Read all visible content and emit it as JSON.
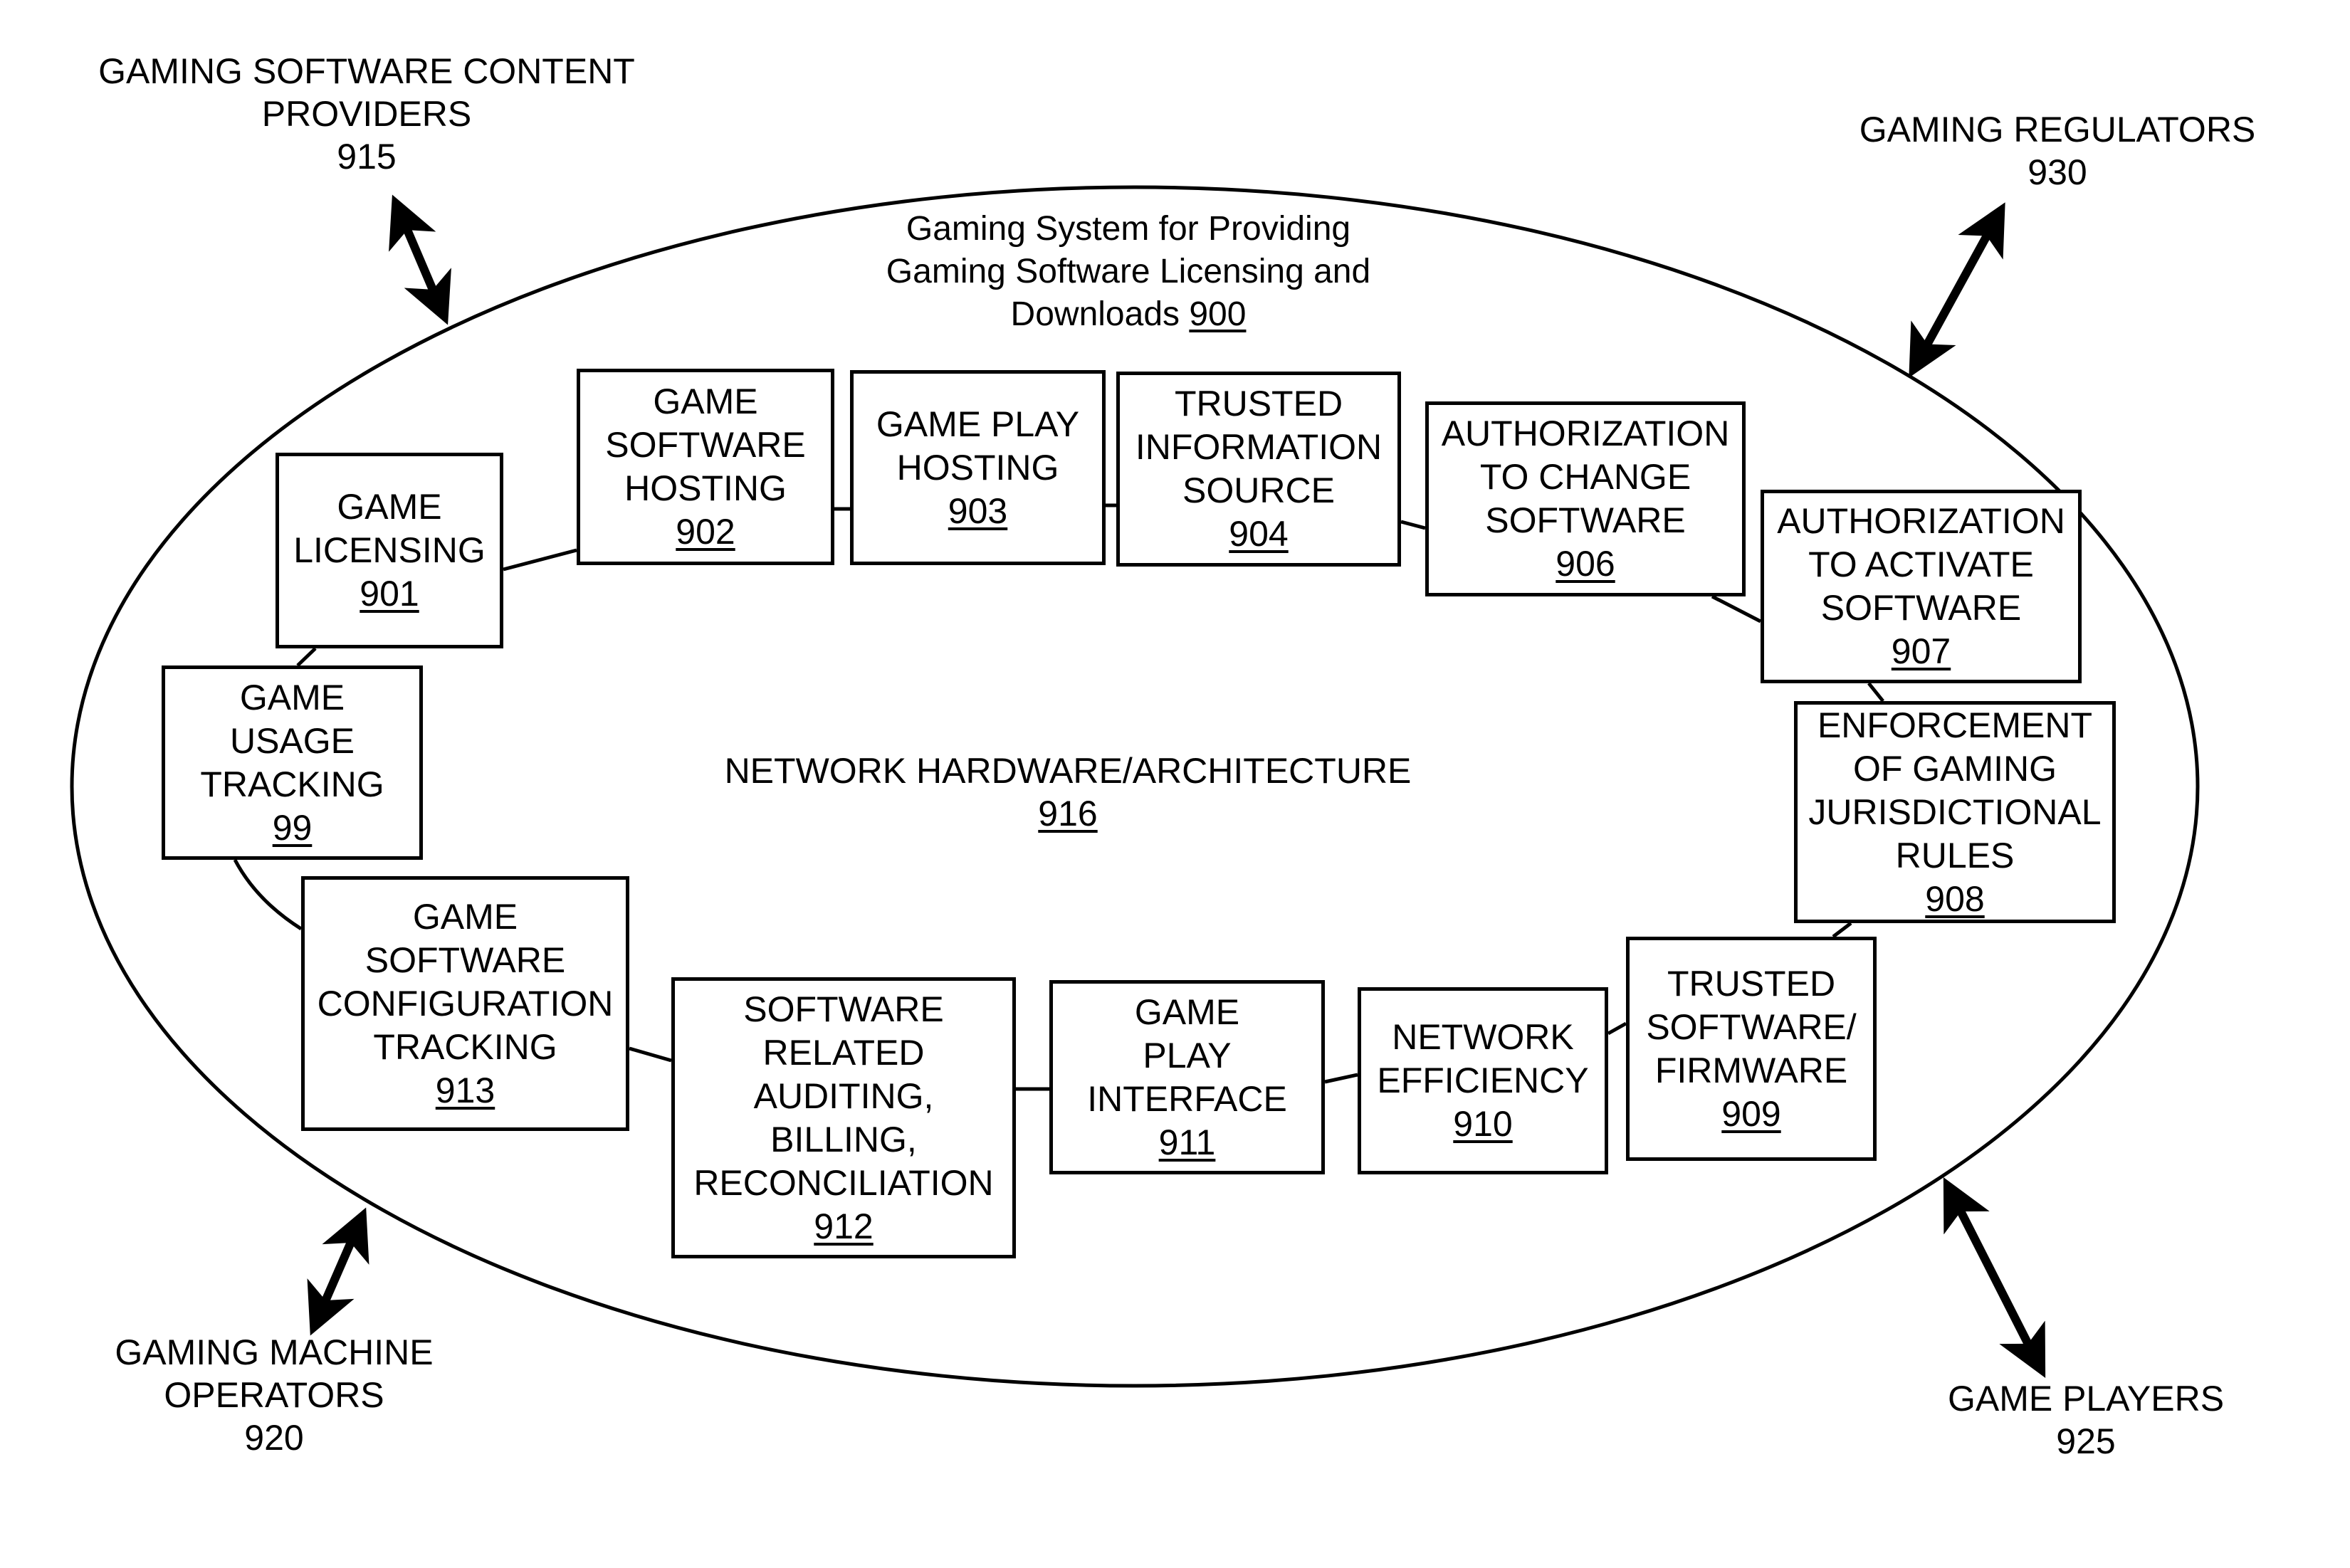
{
  "system": {
    "title_lines": [
      "Gaming System for Providing",
      "Gaming  Software Licensing and",
      "Downloads"
    ],
    "ref": "900"
  },
  "network": {
    "label": "NETWORK HARDWARE/ARCHITECTURE",
    "ref": "916"
  },
  "external_entities": [
    {
      "id": "content-providers",
      "lines": [
        "GAMING SOFTWARE CONTENT",
        "PROVIDERS"
      ],
      "ref": "915"
    },
    {
      "id": "regulators",
      "lines": [
        "GAMING REGULATORS"
      ],
      "ref": "930"
    },
    {
      "id": "machine-operators",
      "lines": [
        "GAMING MACHINE",
        "OPERATORS"
      ],
      "ref": "920"
    },
    {
      "id": "game-players",
      "lines": [
        "GAME PLAYERS"
      ],
      "ref": "925"
    }
  ],
  "modules": [
    {
      "id": "game-licensing",
      "lines": [
        "GAME",
        "LICENSING"
      ],
      "ref": "901"
    },
    {
      "id": "game-software-hosting",
      "lines": [
        "GAME",
        "SOFTWARE",
        "HOSTING"
      ],
      "ref": "902"
    },
    {
      "id": "game-play-hosting",
      "lines": [
        "GAME PLAY",
        "HOSTING"
      ],
      "ref": "903"
    },
    {
      "id": "trusted-information-source",
      "lines": [
        "TRUSTED",
        "INFORMATION",
        "SOURCE"
      ],
      "ref": "904"
    },
    {
      "id": "authorization-to-change-software",
      "lines": [
        "AUTHORIZATION",
        "TO CHANGE",
        "SOFTWARE"
      ],
      "ref": "906"
    },
    {
      "id": "authorization-to-activate-software",
      "lines": [
        "AUTHORIZATION",
        "TO ACTIVATE",
        "SOFTWARE"
      ],
      "ref": "907"
    },
    {
      "id": "enforcement-of-gaming-jurisdictional-rules",
      "lines": [
        "ENFORCEMENT",
        "OF GAMING",
        "JURISDICTIONAL",
        "RULES"
      ],
      "ref": "908"
    },
    {
      "id": "trusted-software-firmware",
      "lines": [
        "TRUSTED",
        "SOFTWARE/",
        "FIRMWARE"
      ],
      "ref": "909"
    },
    {
      "id": "network-efficiency",
      "lines": [
        "NETWORK",
        "EFFICIENCY"
      ],
      "ref": "910"
    },
    {
      "id": "game-play-interface",
      "lines": [
        "GAME",
        "PLAY",
        "INTERFACE"
      ],
      "ref": "911"
    },
    {
      "id": "software-auditing-billing-reconciliation",
      "lines": [
        "SOFTWARE",
        "RELATED",
        "AUDITING,",
        "BILLING,",
        "RECONCILIATION"
      ],
      "ref": "912"
    },
    {
      "id": "game-software-configuration-tracking",
      "lines": [
        "GAME",
        "SOFTWARE",
        "CONFIGURATION",
        "TRACKING"
      ],
      "ref": "913"
    },
    {
      "id": "game-usage-tracking",
      "lines": [
        "GAME",
        "USAGE",
        "TRACKING"
      ],
      "ref": "99"
    }
  ]
}
